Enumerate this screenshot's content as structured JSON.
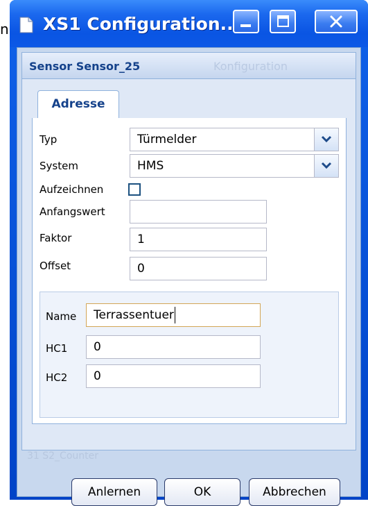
{
  "stray_text": "n",
  "window": {
    "title": "XS1 Configuration...",
    "colors": {
      "titlebar": "#0a55e3",
      "panel": "#dfe8f6",
      "label_blue": "#15428b"
    }
  },
  "panel": {
    "title": "Sensor Sensor_25",
    "ghost_tab_label": "Konfiguration",
    "tabs": [
      {
        "label": "Adresse",
        "active": true
      }
    ]
  },
  "form": {
    "typ": {
      "label": "Typ",
      "value": "Türmelder"
    },
    "system": {
      "label": "System",
      "value": "HMS"
    },
    "aufzeichnen": {
      "label": "Aufzeichnen",
      "checked": false
    },
    "anfangswert": {
      "label": "Anfangswert",
      "value": ""
    },
    "faktor": {
      "label": "Faktor",
      "value": "1"
    },
    "offset": {
      "label": "Offset",
      "value": "0"
    }
  },
  "address": {
    "name": {
      "label": "Name",
      "value": "Terrassentuer"
    },
    "hc1": {
      "label": "HC1",
      "value": "0"
    },
    "hc2": {
      "label": "HC2",
      "value": "0"
    }
  },
  "ghost_row_text": "31     S2_Counter",
  "buttons": {
    "anlernen": "Anlernen",
    "ok": "OK",
    "abbrechen": "Abbrechen"
  }
}
